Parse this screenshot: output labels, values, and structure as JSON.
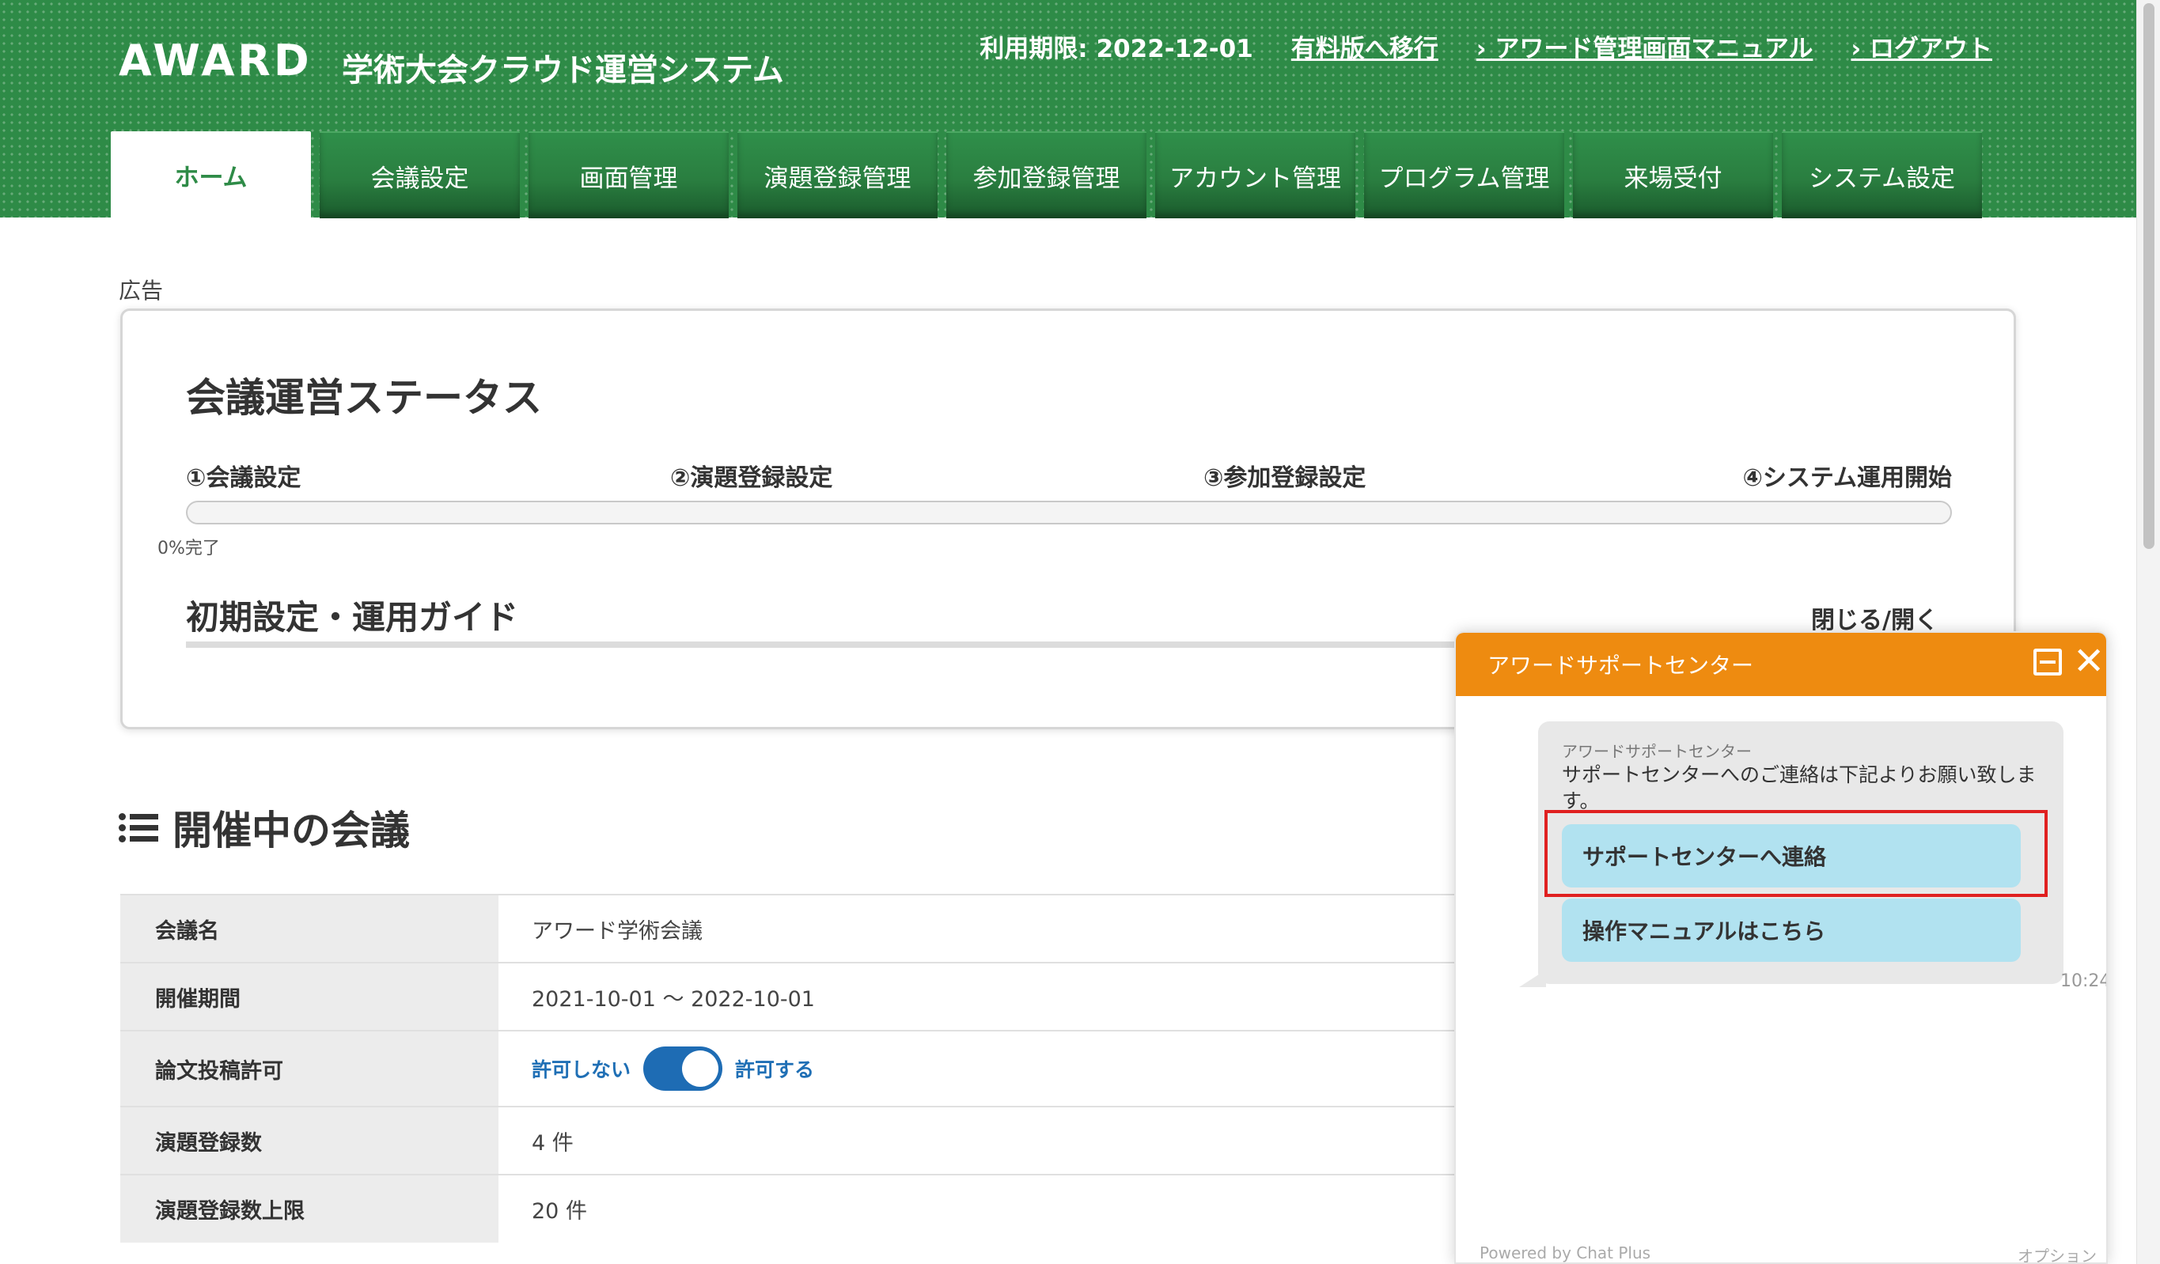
{
  "header": {
    "logo": "AWARD",
    "site_title": "学術大会クラウド運営システム",
    "expiry": "利用期限: 2022-12-01",
    "links": {
      "upgrade": "有料版へ移行",
      "manual": "› アワード管理画面マニュアル",
      "logout": "› ログアウト"
    }
  },
  "tabs": [
    {
      "label": "ホーム",
      "active": true
    },
    {
      "label": "会議設定"
    },
    {
      "label": "画面管理"
    },
    {
      "label": "演題登録管理"
    },
    {
      "label": "参加登録管理"
    },
    {
      "label": "アカウント管理"
    },
    {
      "label": "プログラム管理"
    },
    {
      "label": "来場受付"
    },
    {
      "label": "システム設定"
    }
  ],
  "ad_label": "広告",
  "status": {
    "title": "会議運営ステータス",
    "steps": [
      "①会議設定",
      "②演題登録設定",
      "③参加登録設定",
      "④システム運用開始"
    ],
    "progress_percent": 0,
    "progress_text": "0%完了",
    "guide_title": "初期設定・運用ガイド",
    "guide_toggle": "閉じる/開く"
  },
  "meetings": {
    "title": "開催中の会議",
    "rows": [
      {
        "label": "会議名",
        "value": "アワード学術会議"
      },
      {
        "label": "開催期間",
        "value": "2021-10-01 〜 2022-10-01"
      },
      {
        "label": "論文投稿許可",
        "off_label": "許可しない",
        "on_label": "許可する",
        "toggle_on": true
      },
      {
        "label": "演題登録数",
        "value": "4 件"
      },
      {
        "label": "演題登録数上限",
        "value": "20 件"
      }
    ]
  },
  "chat": {
    "title": "アワードサポートセンター",
    "sender": "アワードサポートセンター",
    "message": "サポートセンターへのご連絡は下記よりお願い致します。",
    "options": [
      "サポートセンターへ連絡",
      "操作マニュアルはこちら"
    ],
    "time": "10:24",
    "powered_by": "Powered by Chat Plus",
    "options_link": "オプション"
  },
  "colors": {
    "header_green": "#2e8b47",
    "chat_orange": "#ee8b10",
    "button_blue": "#b1e2f0",
    "toggle_blue": "#1e6cb4",
    "highlight_red": "#e02020"
  }
}
